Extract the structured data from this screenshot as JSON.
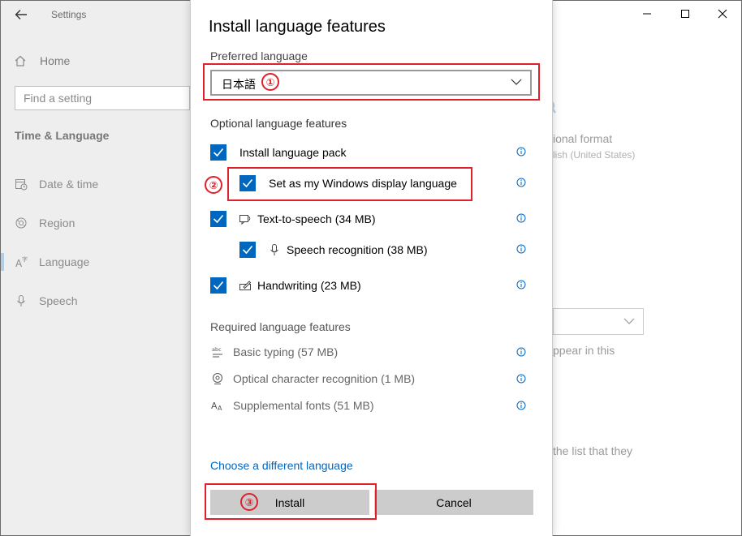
{
  "settings": {
    "app_title": "Settings",
    "home_label": "Home",
    "search_placeholder": "Find a setting",
    "section_title": "Time & Language",
    "nav": [
      {
        "label": "Date & time",
        "icon": "calendar-clock-icon"
      },
      {
        "label": "Region",
        "icon": "globe-icon"
      },
      {
        "label": "Language",
        "icon": "language-icon"
      },
      {
        "label": "Speech",
        "icon": "microphone-icon"
      }
    ],
    "active_index": 2
  },
  "background": {
    "regional_format": "ional format",
    "regional_value": "lish (United States)",
    "appear_text": "ppear in this",
    "list_text": "the list that they"
  },
  "dialog": {
    "title": "Install language features",
    "preferred_label": "Preferred language",
    "preferred_value": "日本語",
    "optional_label": "Optional language features",
    "optional": [
      {
        "label": "Install language pack",
        "checked": true,
        "icon": null
      },
      {
        "label": "Set as my Windows display language",
        "checked": true,
        "icon": null
      },
      {
        "label": "Text-to-speech (34 MB)",
        "checked": true,
        "icon": "speech-bubble-icon"
      },
      {
        "label": "Speech recognition (38 MB)",
        "checked": true,
        "icon": "microphone-icon"
      },
      {
        "label": "Handwriting (23 MB)",
        "checked": true,
        "icon": "pen-icon"
      }
    ],
    "required_label": "Required language features",
    "required": [
      {
        "label": "Basic typing (57 MB)",
        "icon": "abc-icon"
      },
      {
        "label": "Optical character recognition (1 MB)",
        "icon": "camera-icon"
      },
      {
        "label": "Supplemental fonts (51 MB)",
        "icon": "font-icon"
      }
    ],
    "choose_link": "Choose a different language",
    "install_label": "Install",
    "cancel_label": "Cancel"
  },
  "annotations": {
    "step1": "①",
    "step2": "②",
    "step3": "③",
    "color": "#e0202c"
  },
  "accent_color": "#0067c0"
}
